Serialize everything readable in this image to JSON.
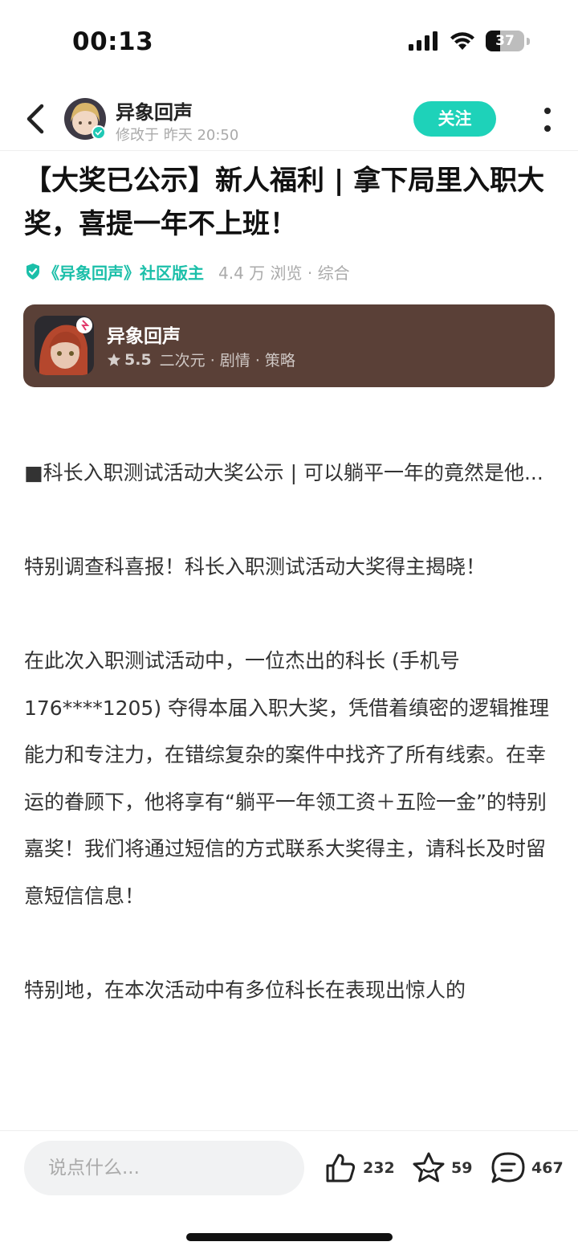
{
  "status_bar": {
    "time": "00:13",
    "battery": "37"
  },
  "header": {
    "author_name": "异象回声",
    "author_meta": "修改于 昨天 20:50",
    "follow_label": "关注"
  },
  "post": {
    "title": "【大奖已公示】新人福利 | 拿下局里入职大奖，喜提一年不上班！",
    "moderator_label": "《异象回声》社区版主",
    "stats": "4.4 万 浏览 · 综合"
  },
  "game_card": {
    "name": "异象回声",
    "rating": "5.5",
    "tags": "二次元 · 剧情 · 策略"
  },
  "content": {
    "p1": "■科长入职测试活动大奖公示 | 可以躺平一年的竟然是他...",
    "p2": "特别调查科喜报！科长入职测试活动大奖得主揭晓！",
    "p3": "在此次入职测试活动中，一位杰出的科长 (手机号 176****1205) 夺得本届入职大奖，凭借着缜密的逻辑推理能力和专注力，在错综复杂的案件中找齐了所有线索。在幸运的眷顾下，他将享有“躺平一年领工资＋五险一金”的特别嘉奖！我们将通过短信的方式联系大奖得主，请科长及时留意短信信息！",
    "p4": "特别地，在本次活动中有多位科长在表现出惊人的"
  },
  "bottom_bar": {
    "comment_placeholder": "说点什么...",
    "like_count": "232",
    "favorite_count": "59",
    "comment_count": "467"
  },
  "colors": {
    "accent": "#1ed2b9",
    "moderator": "#1bbfa9",
    "card_bg": "#5a4037"
  }
}
